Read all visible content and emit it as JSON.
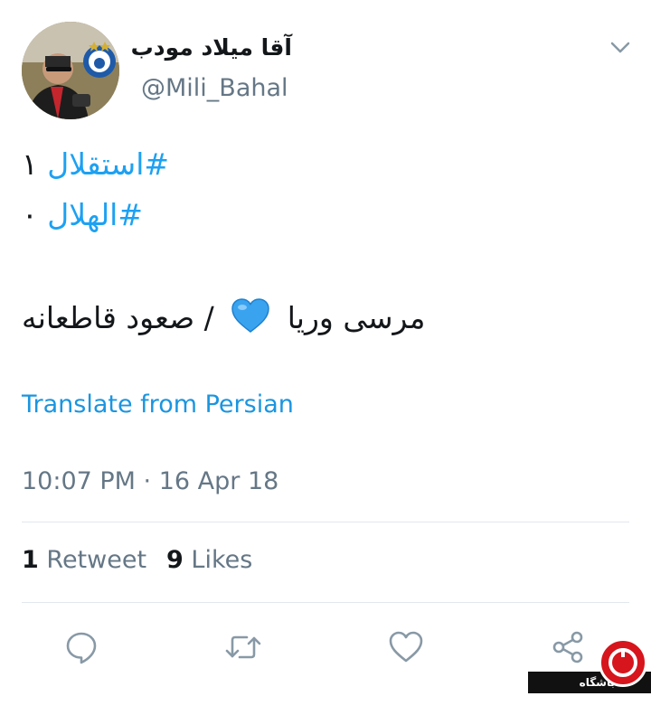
{
  "colors": {
    "accent": "#1da1f2",
    "link": "#1b95e0",
    "secondary_text": "#657786",
    "divider": "#e1e8ed",
    "heart_emoji": "#3aa3f0"
  },
  "user": {
    "display_name": "آقا میلاد مودب",
    "handle": "@Mili_Bahal",
    "avatar_icon": "avatar-photo",
    "menu_icon": "chevron-down-icon"
  },
  "tweet": {
    "line1": {
      "hashtag": "#استقلال",
      "text": "۱"
    },
    "line2": {
      "hashtag": "#الهلال",
      "text": "۰"
    },
    "line3": {
      "left_text": "صعود قاطعانه",
      "separator": "/",
      "emoji": "blue-heart-emoji",
      "right_text": "مرسی وریا"
    },
    "translate_label": "Translate from Persian",
    "timestamp": "10:07 PM · 16 Apr 18"
  },
  "stats": {
    "retweet_count": "1",
    "retweet_label": "Retweet",
    "likes_count": "9",
    "likes_label": "Likes"
  },
  "actions": [
    {
      "name": "reply",
      "icon": "reply-icon"
    },
    {
      "name": "retweet",
      "icon": "retweet-icon"
    },
    {
      "name": "like",
      "icon": "heart-icon"
    },
    {
      "name": "share",
      "icon": "share-icon"
    }
  ],
  "watermark": {
    "text": "باشگاه خبرنگاران"
  }
}
